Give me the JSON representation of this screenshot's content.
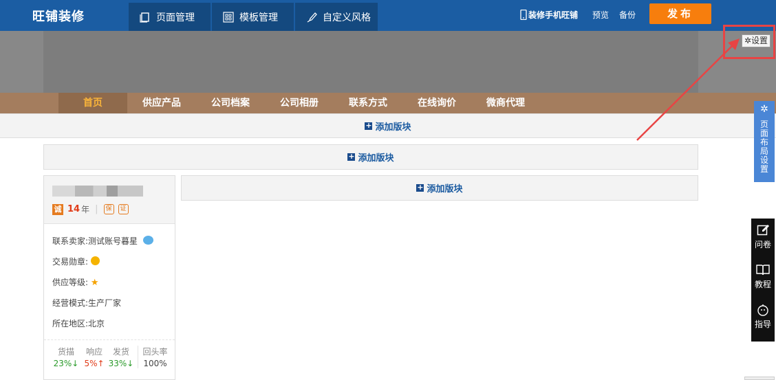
{
  "header": {
    "logo": "旺铺装修",
    "tabs": [
      "页面管理",
      "模板管理",
      "自定义风格"
    ],
    "mobile_link": "装修手机旺铺",
    "preview": "预览",
    "backup": "备份",
    "publish": "发布"
  },
  "banner": {
    "settings_label": "设置"
  },
  "nav": [
    "首页",
    "供应产品",
    "公司档案",
    "公司相册",
    "联系方式",
    "在线询价",
    "微商代理"
  ],
  "add_block_label": "添加版块",
  "seller": {
    "years_num": "14",
    "years_unit": "年",
    "contact_label": "联系卖家:",
    "contact_value": "测试账号暮星",
    "medal_label": "交易勋章:",
    "level_label": "供应等级:",
    "mode_label": "经营模式:",
    "mode_value": "生产厂家",
    "region_label": "所在地区:",
    "region_value": "北京",
    "stats": [
      {
        "label": "货描",
        "value": "23%↓"
      },
      {
        "label": "响应",
        "value": "5%↑"
      },
      {
        "label": "发货",
        "value": "33%↓"
      },
      {
        "label": "回头率",
        "value": "100%"
      }
    ]
  },
  "side": {
    "layout_label": "页面布局设置",
    "tools": [
      "问卷",
      "教程",
      "指导"
    ]
  },
  "colors": {
    "accent": "#1b5da3",
    "publish": "#f77e0d",
    "nav": "#a47d5e",
    "annotation": "#e84444"
  }
}
